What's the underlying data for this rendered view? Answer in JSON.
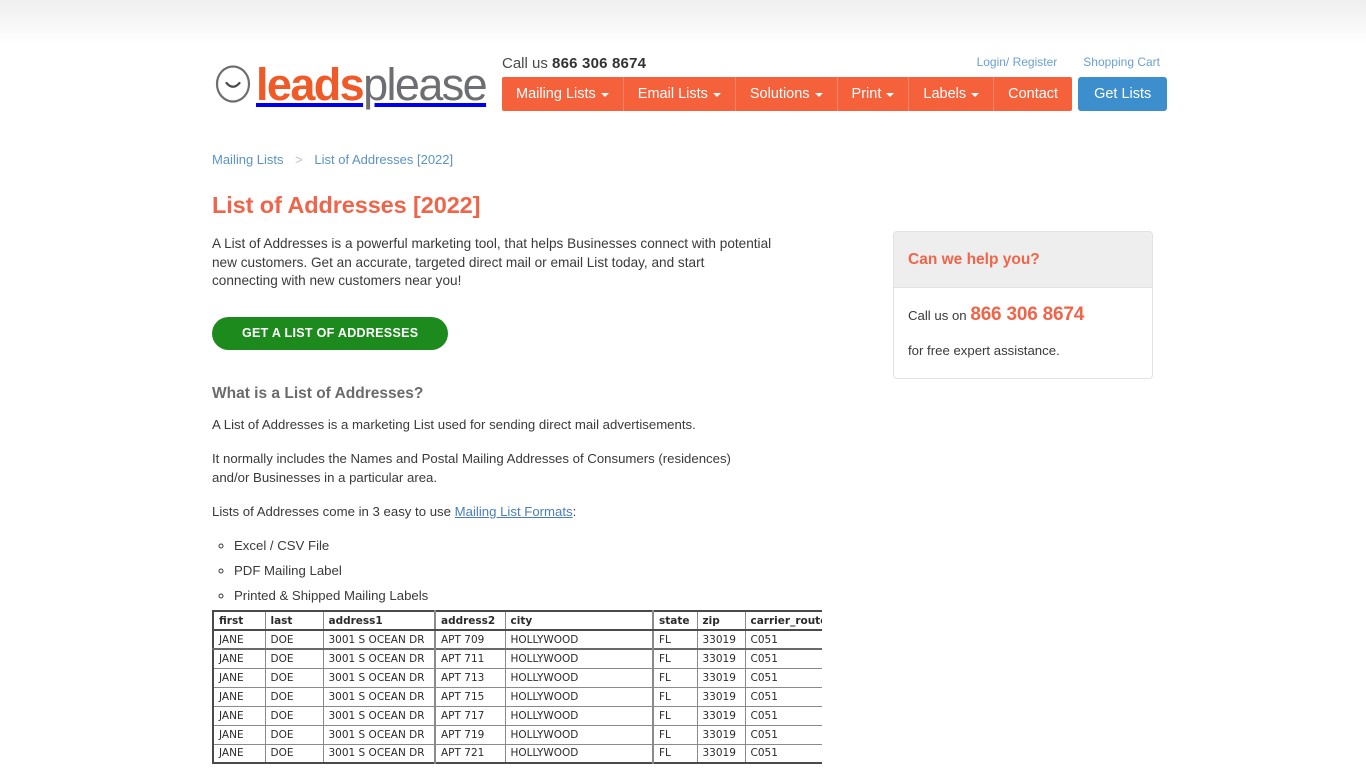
{
  "brand": {
    "logo_leads": "leads",
    "logo_please": "please",
    "logo_mark": "smiley-face-icon"
  },
  "header": {
    "call_us_prefix": "Call us",
    "call_us_number": "866 306 8674",
    "top_links": [
      {
        "label": "Login/ Register",
        "name": "login-register-link"
      },
      {
        "label": "Shopping Cart",
        "name": "shopping-cart-link"
      }
    ],
    "nav": [
      {
        "label": "Mailing Lists",
        "caret": true
      },
      {
        "label": "Email Lists",
        "caret": true
      },
      {
        "label": "Solutions",
        "caret": true
      },
      {
        "label": "Print",
        "caret": true
      },
      {
        "label": "Labels",
        "caret": true
      },
      {
        "label": "Contact",
        "caret": false
      }
    ],
    "cta_label": "Get Lists",
    "nav_color": "#f4613b",
    "cta_color": "#3d8ecc"
  },
  "breadcrumb": {
    "parent": "Mailing Lists",
    "separator": ">",
    "current": "List of Addresses [2022]"
  },
  "main": {
    "title": "List of Addresses [2022]",
    "intro": "A List of Addresses is a powerful marketing tool, that helps Businesses connect with potential new customers. Get an accurate, targeted direct mail or email List today, and start connecting with new customers near you!",
    "cta_label": "GET A LIST OF ADDRESSES",
    "cta_color": "#1d8a1d",
    "section_title": "What is a List of Addresses?",
    "paragraph_1": "A List of Addresses is a marketing List used for sending direct mail advertisements.",
    "paragraph_2": "It normally includes the Names and Postal Mailing Addresses of Consumers (residences) and/or Businesses in a particular area.",
    "paragraph_3_prefix": "Lists of Addresses come in 3 easy to use ",
    "paragraph_3_link": "Mailing List Formats",
    "paragraph_3_suffix": ":",
    "formats": [
      "Excel / CSV File",
      "PDF Mailing Label",
      "Printed & Shipped Mailing Labels"
    ]
  },
  "help_box": {
    "title": "Can we help you?",
    "call_prefix": "Call us on",
    "phone": "866 306 8674",
    "note": "for free expert assistance.",
    "title_color": "#f0654a"
  },
  "sample_table": {
    "columns": [
      "first",
      "last",
      "address1",
      "address2",
      "city",
      "state",
      "zip",
      "carrier_route"
    ],
    "rows": [
      [
        "JANE",
        "DOE",
        "3001 S OCEAN DR",
        "APT 709",
        "HOLLYWOOD",
        "FL",
        "33019",
        "C051"
      ],
      [
        "JANE",
        "DOE",
        "3001 S OCEAN DR",
        "APT 711",
        "HOLLYWOOD",
        "FL",
        "33019",
        "C051"
      ],
      [
        "JANE",
        "DOE",
        "3001 S OCEAN DR",
        "APT 713",
        "HOLLYWOOD",
        "FL",
        "33019",
        "C051"
      ],
      [
        "JANE",
        "DOE",
        "3001 S OCEAN DR",
        "APT 715",
        "HOLLYWOOD",
        "FL",
        "33019",
        "C051"
      ],
      [
        "JANE",
        "DOE",
        "3001 S OCEAN DR",
        "APT 717",
        "HOLLYWOOD",
        "FL",
        "33019",
        "C051"
      ],
      [
        "JANE",
        "DOE",
        "3001 S OCEAN DR",
        "APT 719",
        "HOLLYWOOD",
        "FL",
        "33019",
        "C051"
      ],
      [
        "JANE",
        "DOE",
        "3001 S OCEAN DR",
        "APT 721",
        "HOLLYWOOD",
        "FL",
        "33019",
        "C051"
      ]
    ]
  }
}
